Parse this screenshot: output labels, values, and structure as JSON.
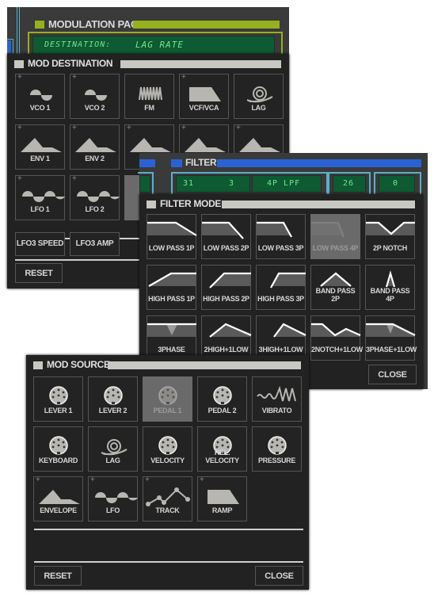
{
  "modulation_page": {
    "title": "MODULATION PAGE",
    "destination_label": "DESTINATION:",
    "destination_value": "LAG RATE",
    "accent_color": "#95b01e"
  },
  "mod_destination": {
    "title": "MOD DESTINATION",
    "tiles": [
      {
        "label": "VCO 1",
        "icon": "sine-wave-icon",
        "plus": true
      },
      {
        "label": "VCO 2",
        "icon": "sine-wave-icon",
        "plus": true
      },
      {
        "label": "FM",
        "icon": "fm-wave-icon",
        "plus": false
      },
      {
        "label": "VCF/VCA",
        "icon": "ramp-shape-icon",
        "plus": true
      },
      {
        "label": "LAG",
        "icon": "snail-icon",
        "plus": false
      },
      {
        "label": "ENV 1",
        "icon": "envelope-icon",
        "plus": true
      },
      {
        "label": "ENV 2",
        "icon": "envelope-icon",
        "plus": true
      },
      {
        "label": "",
        "icon": "envelope-icon",
        "plus": true
      },
      {
        "label": "",
        "icon": "envelope-icon",
        "plus": true
      },
      {
        "label": "",
        "icon": "envelope-icon",
        "plus": true
      },
      {
        "label": "LFO 1",
        "icon": "lfo-wave-icon",
        "plus": true
      },
      {
        "label": "LFO 2",
        "icon": "lfo-wave-icon",
        "plus": true
      }
    ],
    "extra_buttons": [
      "LFO3 SPEED",
      "LFO3 AMP"
    ],
    "reset_label": "RESET"
  },
  "filter": {
    "title": "FILTER",
    "lcd_values": [
      "31",
      "3",
      "4P LPF",
      "26",
      "0"
    ],
    "accent_color": "#2a62d6"
  },
  "filter_mode": {
    "title": "FILTER MODE",
    "selected": "LOW PASS 4P",
    "tiles": [
      {
        "label": "LOW PASS 1P",
        "icon": "low-pass-1p-icon"
      },
      {
        "label": "LOW PASS 2P",
        "icon": "low-pass-2p-icon"
      },
      {
        "label": "LOW PASS 3P",
        "icon": "low-pass-3p-icon"
      },
      {
        "label": "LOW PASS 4P",
        "icon": "low-pass-4p-icon"
      },
      {
        "label": "2P NOTCH",
        "icon": "notch-icon"
      },
      {
        "label": "HIGH PASS 1P",
        "icon": "high-pass-1p-icon"
      },
      {
        "label": "HIGH PASS 2P",
        "icon": "high-pass-2p-icon"
      },
      {
        "label": "HIGH PASS 3P",
        "icon": "high-pass-3p-icon"
      },
      {
        "label": "BAND PASS 2P",
        "icon": "band-pass-2p-icon"
      },
      {
        "label": "BAND PASS 4P",
        "icon": "band-pass-4p-icon"
      },
      {
        "label": "3PHASE",
        "icon": "3phase-icon"
      },
      {
        "label": "2HIGH+1LOW",
        "icon": "2high-1low-icon"
      },
      {
        "label": "3HIGH+1LOW",
        "icon": "3high-1low-icon"
      },
      {
        "label": "2NOTCH+1LOW",
        "icon": "2notch-1low-icon"
      },
      {
        "label": "3PHASE+1LOW",
        "icon": "3phase-1low-icon"
      }
    ],
    "close_label": "CLOSE"
  },
  "mod_source": {
    "title": "MOD SOURCE",
    "selected": "PEDAL 1",
    "tiles": [
      {
        "label": "LEVER 1",
        "icon": "midi-connector-icon",
        "plus": false
      },
      {
        "label": "LEVER 2",
        "icon": "midi-connector-icon",
        "plus": false
      },
      {
        "label": "PEDAL 1",
        "icon": "midi-connector-icon",
        "plus": false
      },
      {
        "label": "PEDAL 2",
        "icon": "midi-connector-icon",
        "plus": false
      },
      {
        "label": "VIBRATO",
        "icon": "vibrato-wave-icon",
        "plus": false
      },
      {
        "label": "KEYBOARD",
        "icon": "midi-connector-icon",
        "plus": false
      },
      {
        "label": "LAG",
        "icon": "snail-icon",
        "plus": false
      },
      {
        "label": "VELOCITY",
        "icon": "midi-connector-icon",
        "plus": false
      },
      {
        "label": "REL. VELOCITY",
        "icon": "midi-connector-icon",
        "plus": false
      },
      {
        "label": "PRESSURE",
        "icon": "midi-connector-icon",
        "plus": false
      },
      {
        "label": "ENVELOPE",
        "icon": "envelope-icon",
        "plus": true
      },
      {
        "label": "LFO",
        "icon": "lfo-wave-icon",
        "plus": true
      },
      {
        "label": "TRACK",
        "icon": "track-points-icon",
        "plus": true
      },
      {
        "label": "RAMP",
        "icon": "ramp-shape-icon",
        "plus": true
      }
    ],
    "reset_label": "RESET",
    "close_label": "CLOSE"
  }
}
